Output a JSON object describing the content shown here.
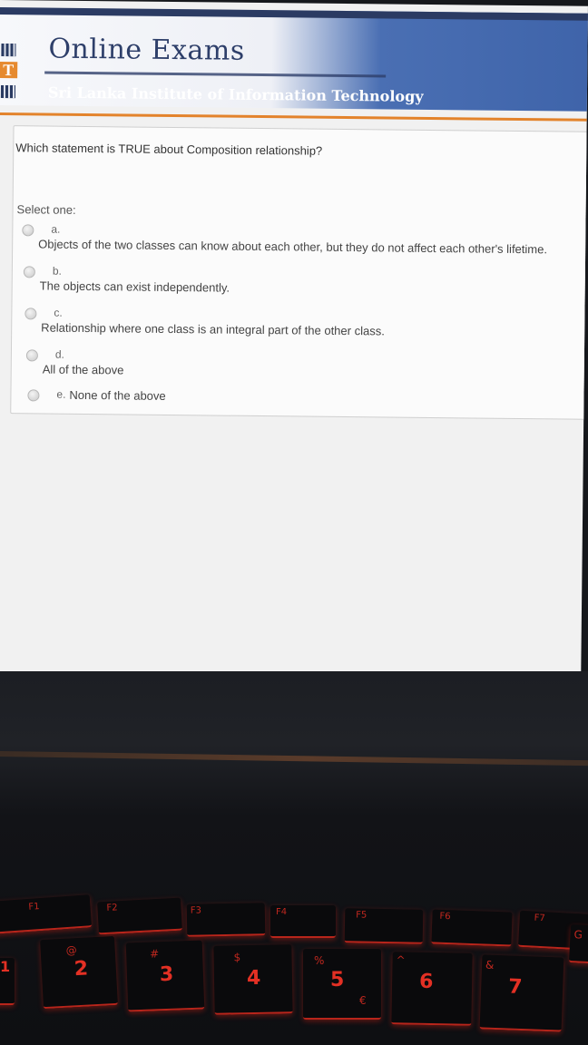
{
  "header": {
    "logo_letter": "T",
    "site_title": "Online Exams",
    "site_subtitle": "Sri Lanka Institute of Information Technology"
  },
  "question": {
    "text": "Which statement is TRUE about Composition relationship?",
    "select_prompt": "Select one:",
    "options": [
      {
        "letter": "a.",
        "text": "Objects of the two classes can know about each other, but they do not affect each other's lifetime."
      },
      {
        "letter": "b.",
        "text": "The objects can exist independently."
      },
      {
        "letter": "c.",
        "text": "Relationship where one class is an integral part of the other class."
      },
      {
        "letter": "d.",
        "text": "All of the above"
      },
      {
        "letter": "e.",
        "text": "None of the above"
      }
    ]
  },
  "keyboard": {
    "function_keys": [
      "F1",
      "F2",
      "F3",
      "F4",
      "F5",
      "F6",
      "F7"
    ],
    "number_keys": [
      {
        "main": "2",
        "shift": "@"
      },
      {
        "main": "3",
        "shift": "#"
      },
      {
        "main": "4",
        "shift": "$"
      },
      {
        "main": "5",
        "shift": "%",
        "alt": "€"
      },
      {
        "main": "6",
        "shift": "^"
      },
      {
        "main": "7",
        "shift": "&"
      }
    ],
    "edge_keys": [
      "1",
      "G"
    ],
    "colors": {
      "backlight": "#e33024",
      "key": "#0a0a0c"
    }
  }
}
